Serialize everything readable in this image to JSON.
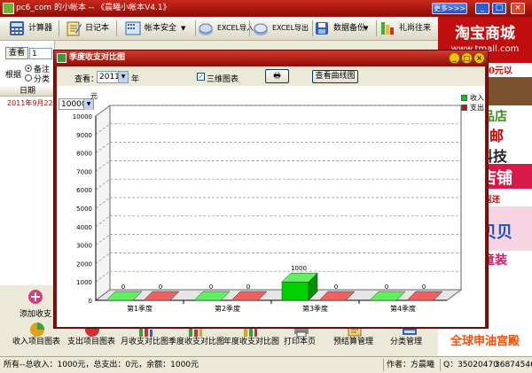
{
  "window": {
    "title": "pc6_com 的小帐本 -- 《晨曦小帐本V4.1》",
    "more_label": "更多>>>",
    "btn_min": "_",
    "btn_max": "□",
    "btn_close": "×"
  },
  "toolbar": {
    "items": [
      {
        "label": "计算器",
        "icon": "calculator-icon"
      },
      {
        "label": "日记本",
        "icon": "notebook-icon"
      },
      {
        "label": "帐本安全",
        "icon": "security-icon"
      },
      {
        "label": "EXCEL导入",
        "icon": "excel-import-icon"
      },
      {
        "label": "EXCEL导出",
        "icon": "excel-export-icon"
      },
      {
        "label": "数据备份",
        "icon": "backup-icon"
      },
      {
        "label": "礼尚往来",
        "icon": "gift-icon"
      }
    ],
    "dropdown_glyph": "▼"
  },
  "left_pane": {
    "view_button": "查看",
    "view_value": "1",
    "group_label": "根据",
    "radio_remark": "备注",
    "radio_category": "分类",
    "header_date": "日期",
    "row_date": "2011年9月22日"
  },
  "ad": {
    "headline": "淘宝商城",
    "sub": "www.tmall.com",
    "t1": "10元以",
    "t2": "品店",
    "t3": "邮",
    "t4": "科技",
    "t5": "店铺",
    "t6": "返还",
    "t7": "贝贝",
    "t8": "童装",
    "bottom": "全球申油宫殿"
  },
  "bottom_bar": {
    "add_label": "添加收支",
    "items": [
      {
        "label": "收入项目图表",
        "icon": "income-chart-icon"
      },
      {
        "label": "支出项目图表",
        "icon": "expense-chart-icon"
      },
      {
        "label": "月收支对比图",
        "icon": "monthly-compare-icon"
      },
      {
        "label": "季度收支对比图",
        "icon": "quarterly-compare-icon"
      },
      {
        "label": "年度收支对比图",
        "icon": "annual-compare-icon"
      },
      {
        "label": "打印本页",
        "icon": "print-icon"
      },
      {
        "label": "预结算管理",
        "icon": "settlement-icon"
      },
      {
        "label": "分类管理",
        "icon": "category-icon"
      }
    ]
  },
  "status": {
    "summary": "所有--总收入：1000元，总支出：0元，余额：1000元",
    "author": "作者：方晨曦",
    "qq": "Q：35020470",
    "tel": "36874546"
  },
  "dialog": {
    "title": "季度收支对比图",
    "view_label": "查看：",
    "year_value": "2011",
    "year_unit": "年",
    "three_d_label": "三维图表",
    "three_d_checked": "✓",
    "print_label": "🖶",
    "curve_button": "查看曲线图",
    "scale_value": "10000"
  },
  "chart_data": {
    "type": "bar",
    "ylabel": "元",
    "ylim": [
      0,
      10000
    ],
    "yticks": [
      0,
      1000,
      2000,
      3000,
      4000,
      5000,
      6000,
      7000,
      8000,
      9000,
      10000
    ],
    "categories": [
      "第1季度",
      "第2季度",
      "第3季度",
      "第4季度"
    ],
    "series": [
      {
        "name": "收入",
        "values": [
          0,
          0,
          1000,
          0
        ],
        "color": "#00d000"
      },
      {
        "name": "支出",
        "values": [
          0,
          0,
          0,
          0
        ],
        "color": "#cc1010"
      }
    ],
    "legend": "top-right",
    "grid": true,
    "three_d": true
  }
}
